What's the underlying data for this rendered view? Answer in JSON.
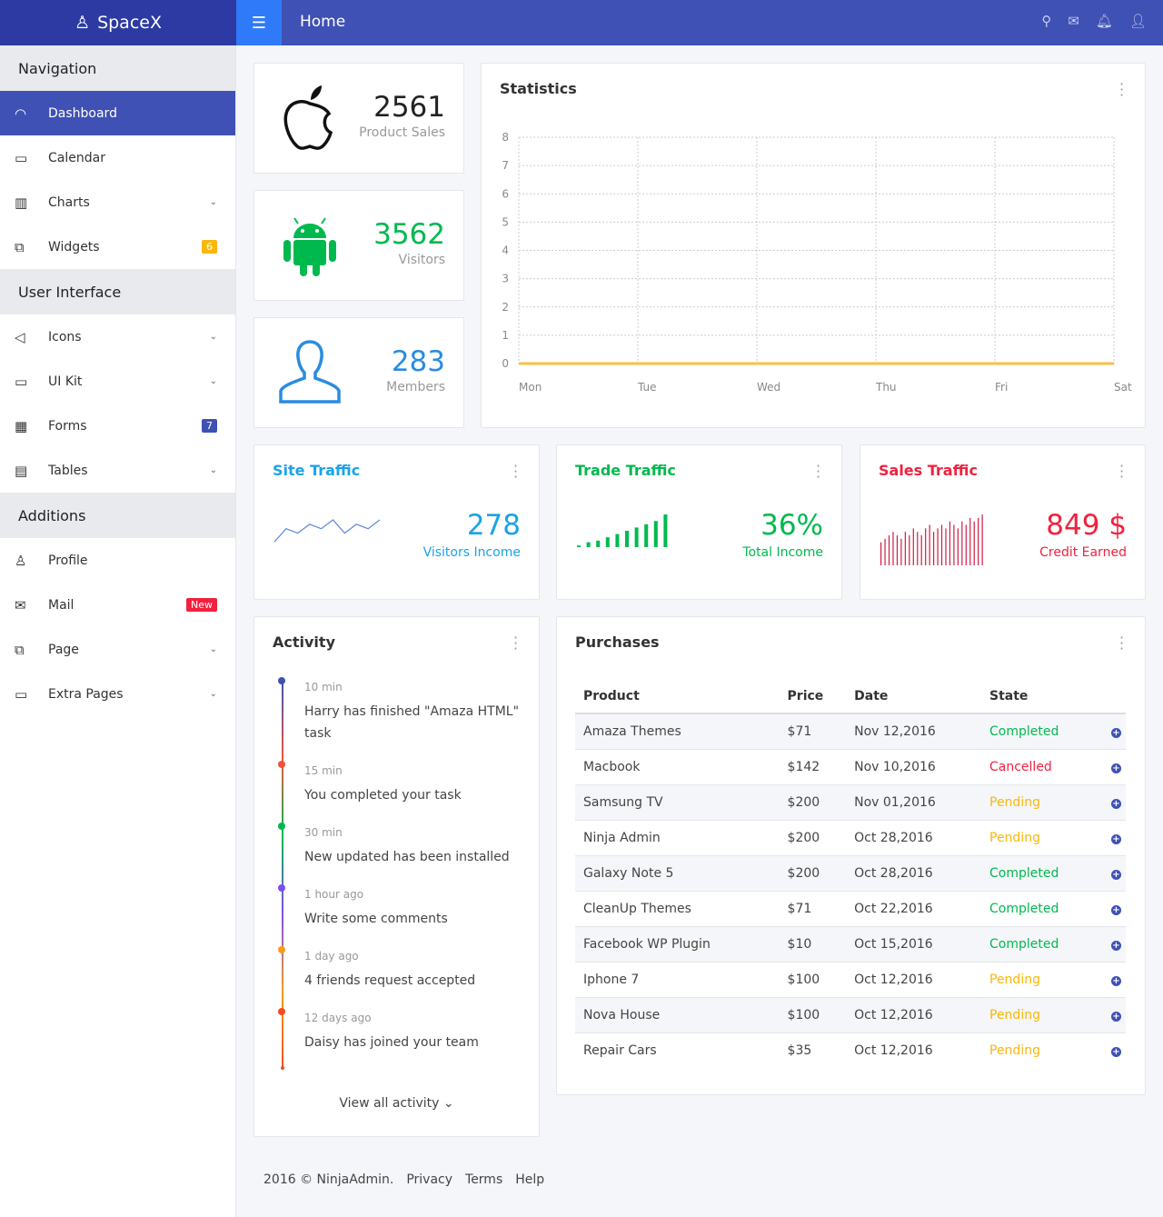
{
  "header": {
    "brand": "SpaceX",
    "title": "Home",
    "icons": [
      "search-icon",
      "mail-icon",
      "bell-icon",
      "user-icon"
    ]
  },
  "sidebar": {
    "sections": [
      {
        "title": "Navigation",
        "items": [
          {
            "label": "Dashboard",
            "icon": "dashboard-icon",
            "active": true
          },
          {
            "label": "Calendar",
            "icon": "calendar-icon"
          },
          {
            "label": "Charts",
            "icon": "chart-icon",
            "chevron": true
          },
          {
            "label": "Widgets",
            "icon": "widgets-icon",
            "badge": "6",
            "badge_color": "#f9b70d"
          }
        ]
      },
      {
        "title": "User Interface",
        "items": [
          {
            "label": "Icons",
            "icon": "icons-icon",
            "chevron": true
          },
          {
            "label": "UI Kit",
            "icon": "monitor-icon",
            "chevron": true
          },
          {
            "label": "Forms",
            "icon": "forms-icon",
            "badge": "7",
            "badge_color": "#3f51b5"
          },
          {
            "label": "Tables",
            "icon": "tables-icon",
            "chevron": true
          }
        ]
      },
      {
        "title": "Additions",
        "items": [
          {
            "label": "Profile",
            "icon": "profile-icon"
          },
          {
            "label": "Mail",
            "icon": "mail-icon",
            "badge": "New",
            "badge_color": "#f2213e"
          },
          {
            "label": "Page",
            "icon": "page-icon",
            "chevron": true
          },
          {
            "label": "Extra Pages",
            "icon": "extra-pages-icon",
            "chevron": true
          }
        ]
      }
    ]
  },
  "stats": [
    {
      "value": "2561",
      "label": "Product Sales",
      "icon": "apple-icon",
      "color": "#222222"
    },
    {
      "value": "3562",
      "label": "Visitors",
      "icon": "android-icon",
      "color": "#00b94e"
    },
    {
      "value": "283",
      "label": "Members",
      "icon": "user-icon",
      "color": "#2a8ce0"
    }
  ],
  "statistics": {
    "title": "Statistics",
    "chart_data": {
      "type": "line",
      "x": [
        "Mon",
        "Tue",
        "Wed",
        "Thu",
        "Fri",
        "Sat"
      ],
      "y_ticks": [
        0,
        1,
        2,
        3,
        4,
        5,
        6,
        7,
        8
      ],
      "ylim": [
        0,
        8
      ],
      "grid": true,
      "series": [
        {
          "values": [
            0,
            0,
            0,
            0,
            0,
            0
          ],
          "color": "#f6c344"
        }
      ]
    }
  },
  "traffic": [
    {
      "title": "Site Traffic",
      "value": "278",
      "label": "Visitors Income",
      "color": "#1aa3e8",
      "spark_type": "line",
      "spark_color": "#5b8ad6",
      "spark": [
        2,
        5,
        4,
        6,
        5,
        7,
        4,
        6,
        5,
        7
      ]
    },
    {
      "title": "Trade Traffic",
      "value": "36%",
      "label": "Total Income",
      "color": "#00b94e",
      "spark_type": "bar",
      "spark_color": "#00b94e",
      "spark": [
        0.5,
        1.5,
        2,
        3,
        4,
        5,
        6,
        7,
        8,
        10
      ]
    },
    {
      "title": "Sales Traffic",
      "value": "849 $",
      "label": "Credit Earned",
      "color": "#f2213e",
      "spark_type": "bar",
      "spark_color": "#d01c45",
      "spark": [
        4,
        5,
        6,
        7,
        6,
        5,
        7,
        6,
        8,
        7,
        6,
        8,
        9,
        7,
        8,
        9,
        8,
        10,
        9,
        8,
        10,
        9,
        11,
        10,
        11,
        12
      ]
    }
  ],
  "activity": {
    "title": "Activity",
    "view_all": "View all activity",
    "items": [
      {
        "time": "10 min",
        "text": "Harry has finished \"Amaza HTML\" task",
        "color": "#3f51b5"
      },
      {
        "time": "15 min",
        "text": "You completed your task",
        "color": "#f2513e"
      },
      {
        "time": "30 min",
        "text": "New updated has been installed",
        "color": "#00b94e"
      },
      {
        "time": "1 hour ago",
        "text": "Write some comments",
        "color": "#7b4ef1"
      },
      {
        "time": "1 day ago",
        "text": "4 friends request accepted",
        "color": "#f99b1d"
      },
      {
        "time": "12 days ago",
        "text": "Daisy has joined your team",
        "color": "#f24e1e"
      }
    ]
  },
  "purchases": {
    "title": "Purchases",
    "columns": [
      "Product",
      "Price",
      "Date",
      "State"
    ],
    "rows": [
      [
        "Amaza Themes",
        "$71",
        "Nov 12,2016",
        "Completed"
      ],
      [
        "Macbook",
        "$142",
        "Nov 10,2016",
        "Cancelled"
      ],
      [
        "Samsung TV",
        "$200",
        "Nov 01,2016",
        "Pending"
      ],
      [
        "Ninja Admin",
        "$200",
        "Oct 28,2016",
        "Pending"
      ],
      [
        "Galaxy Note 5",
        "$200",
        "Oct 28,2016",
        "Completed"
      ],
      [
        "CleanUp Themes",
        "$71",
        "Oct 22,2016",
        "Completed"
      ],
      [
        "Facebook WP Plugin",
        "$10",
        "Oct 15,2016",
        "Completed"
      ],
      [
        "Iphone 7",
        "$100",
        "Oct 12,2016",
        "Pending"
      ],
      [
        "Nova House",
        "$100",
        "Oct 12,2016",
        "Pending"
      ],
      [
        "Repair Cars",
        "$35",
        "Oct 12,2016",
        "Pending"
      ]
    ],
    "state_colors": {
      "Completed": "#00b94e",
      "Cancelled": "#f2213e",
      "Pending": "#f9b70d"
    }
  },
  "footer": {
    "copyright": "2016 © NinjaAdmin.",
    "links": [
      "Privacy",
      "Terms",
      "Help"
    ]
  }
}
